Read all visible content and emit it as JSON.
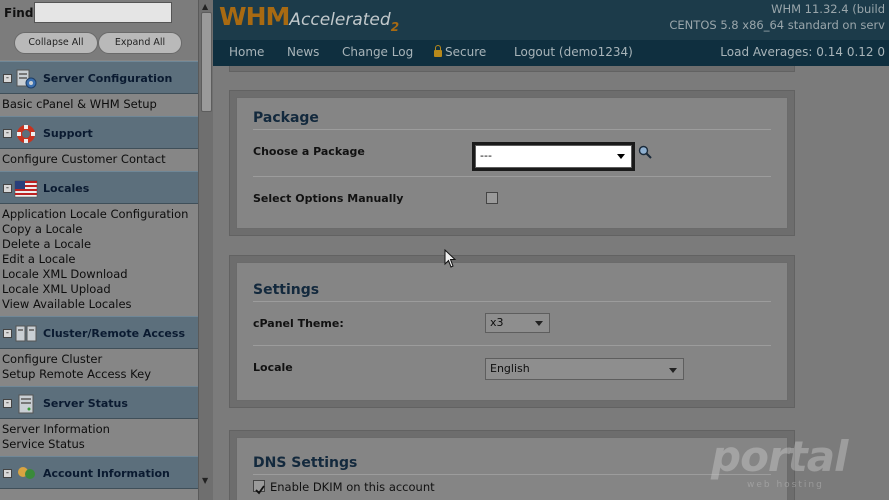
{
  "sidebar": {
    "find_label": "Find",
    "find_value": "",
    "collapse_label": "Collapse All",
    "expand_label": "Expand All",
    "categories": [
      {
        "title": "Server Configuration",
        "icon": "server-config-icon",
        "links": [
          "Basic cPanel & WHM Setup"
        ]
      },
      {
        "title": "Support",
        "icon": "lifebuoy-icon",
        "links": [
          "Configure Customer Contact"
        ]
      },
      {
        "title": "Locales",
        "icon": "us-flag-icon",
        "links": [
          "Application Locale Configuration",
          "Copy a Locale",
          "Delete a Locale",
          "Edit a Locale",
          "Locale XML Download",
          "Locale XML Upload",
          "View Available Locales"
        ]
      },
      {
        "title": "Cluster/Remote Access",
        "icon": "cluster-icon",
        "links": [
          "Configure Cluster",
          "Setup Remote Access Key"
        ]
      },
      {
        "title": "Server Status",
        "icon": "server-status-icon",
        "links": [
          "Server Information",
          "Service Status"
        ]
      },
      {
        "title": "Account Information",
        "icon": "account-info-icon",
        "links": []
      }
    ]
  },
  "header": {
    "logo_main": "WHM",
    "logo_accent": "Accelerated",
    "logo_sub": "2",
    "version_line": "WHM 11.32.4 (build",
    "os_line": "CENTOS 5.8 x86_64 standard on serv"
  },
  "nav": {
    "items": [
      "Home",
      "News",
      "Change Log",
      "Secure",
      "Logout (demo1234)"
    ],
    "load_averages": "Load Averages: 0.14 0.12 0"
  },
  "package_section": {
    "title": "Package",
    "choose_label": "Choose a Package",
    "choose_value": "---",
    "manual_label": "Select Options Manually",
    "manual_checked": false
  },
  "settings_section": {
    "title": "Settings",
    "theme_label": "cPanel Theme:",
    "theme_value": "x3",
    "locale_label": "Locale",
    "locale_value": "English"
  },
  "dns_section": {
    "title": "DNS Settings",
    "dkim_label": "Enable DKIM on this account",
    "dkim_checked": true
  },
  "watermark": {
    "text": "portal",
    "sub": "web hosting"
  },
  "colors": {
    "header_bg": "#1c3b4a",
    "logo_orange": "#a86a12",
    "section_title": "#13293d"
  }
}
